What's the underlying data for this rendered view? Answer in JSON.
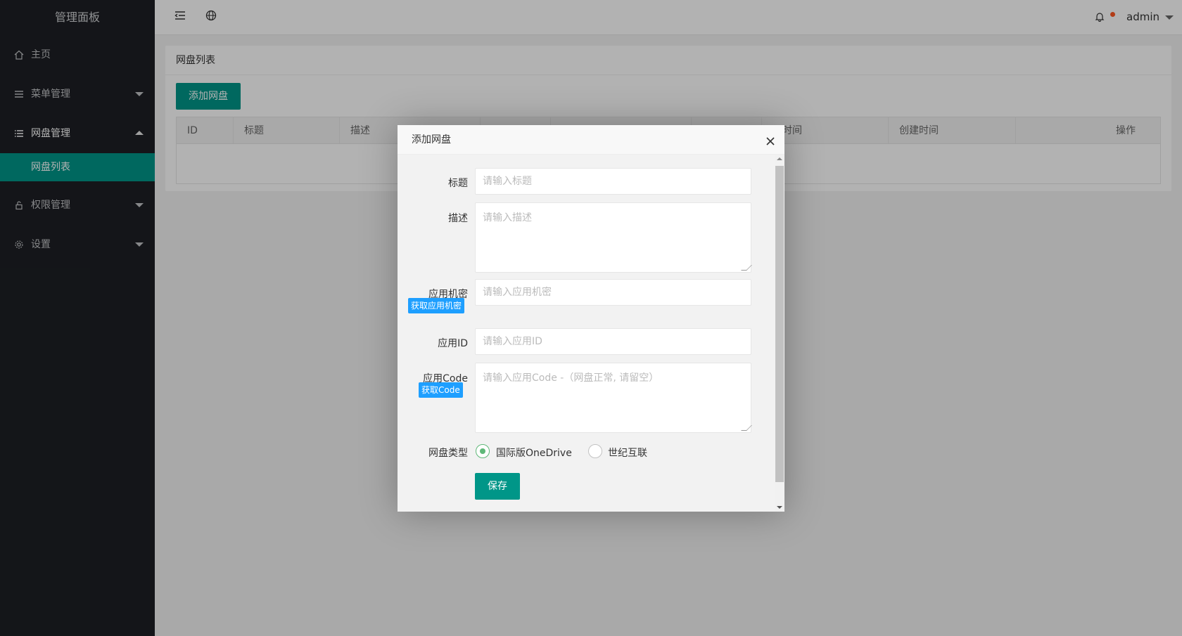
{
  "sidebar": {
    "brand": "管理面板",
    "items": [
      {
        "label": "主页",
        "icon": "home-icon"
      },
      {
        "label": "菜单管理",
        "icon": "menu-icon"
      },
      {
        "label": "网盘管理",
        "icon": "list-icon"
      },
      {
        "label": "权限管理",
        "icon": "lock-icon"
      },
      {
        "label": "设置",
        "icon": "gear-icon"
      }
    ],
    "sub_item": "网盘列表"
  },
  "topbar": {
    "user": "admin"
  },
  "card": {
    "title": "网盘列表",
    "add_button": "添加网盘",
    "columns": [
      "ID",
      "标题",
      "描述",
      "",
      "",
      "",
      "新时间",
      "创建时间",
      "操作"
    ]
  },
  "modal": {
    "title": "添加网盘",
    "fields": {
      "title_label": "标题",
      "title_placeholder": "请输入标题",
      "desc_label": "描述",
      "desc_placeholder": "请输入描述",
      "secret_label": "应用机密",
      "secret_button": "获取应用机密",
      "secret_placeholder": "请输入应用机密",
      "appid_label": "应用ID",
      "appid_placeholder": "请输入应用ID",
      "code_label": "应用Code",
      "code_button": "获取Code",
      "code_placeholder": "请输入应用Code -（网盘正常, 请留空）",
      "type_label": "网盘类型",
      "type_options": [
        "国际版OneDrive",
        "世纪互联"
      ],
      "type_selected": "国际版OneDrive"
    },
    "save_button": "保存"
  },
  "colors": {
    "accent": "#009688",
    "sidebar_bg": "#1d1f24",
    "tag_blue": "#1e9fff",
    "radio_green": "#5fb878",
    "badge_dot": "#ff5722"
  }
}
